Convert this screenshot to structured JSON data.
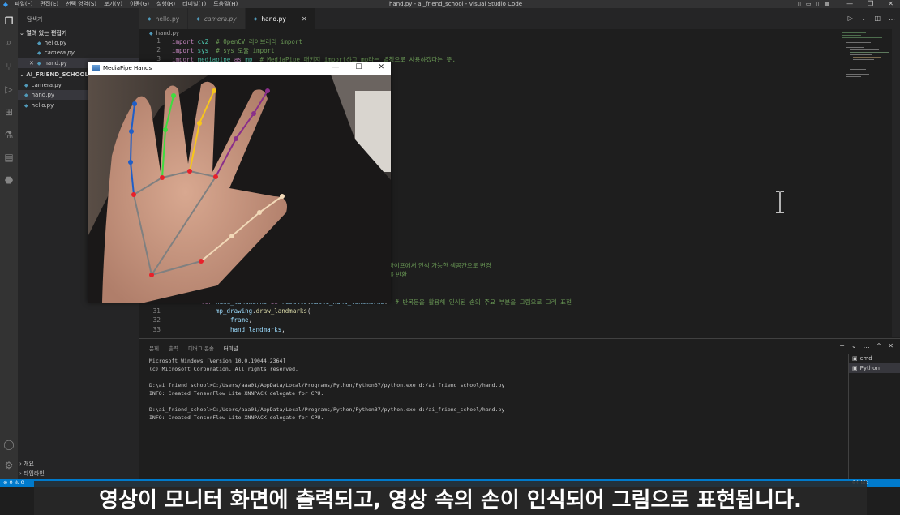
{
  "window": {
    "title": "hand.py - ai_friend_school - Visual Studio Code",
    "menu": [
      "파일(F)",
      "편집(E)",
      "선택 영역(S)",
      "보기(V)",
      "이동(G)",
      "실행(R)",
      "터미널(T)",
      "도움말(H)"
    ]
  },
  "sidebar": {
    "header": "탐색기",
    "open_editors_title": "열려 있는 편집기",
    "open_editors": [
      "hello.py",
      "camera.py",
      "hand.py"
    ],
    "folder_title": "AI_FRIEND_SCHOOL",
    "files": [
      "camera.py",
      "hand.py",
      "hello.py"
    ],
    "outline": "개요",
    "timeline": "타임라인"
  },
  "tabs": [
    {
      "label": "hello.py",
      "active": false,
      "italic": false
    },
    {
      "label": "camera.py",
      "active": false,
      "italic": true
    },
    {
      "label": "hand.py",
      "active": true,
      "italic": false
    }
  ],
  "breadcrumb": "hand.py",
  "code": {
    "lines_top": [
      {
        "n": "1",
        "parts": [
          [
            "kw",
            "import "
          ],
          [
            "mod",
            "cv2"
          ],
          [
            "txt",
            "  "
          ],
          [
            "cm",
            "# OpenCV 라이브러리 import"
          ]
        ]
      },
      {
        "n": "2",
        "parts": [
          [
            "kw",
            "import "
          ],
          [
            "mod",
            "sys"
          ],
          [
            "txt",
            "  "
          ],
          [
            "cm",
            "# sys 모듈 import"
          ]
        ]
      },
      {
        "n": "3",
        "parts": [
          [
            "kw",
            "import "
          ],
          [
            "mod",
            "mediapipe"
          ],
          [
            "kw",
            " as "
          ],
          [
            "mod",
            "mp"
          ],
          [
            "txt",
            "  "
          ],
          [
            "cm",
            "# MediaPipe 패키지 import하고 mp라는 별칭으로 사용하겠다는 뜻."
          ]
        ]
      }
    ],
    "fragment_1": "파이프에서 인식 가능한 색공간으로 변경",
    "fragment_2": "를 반환",
    "lines_bottom": [
      {
        "n": "30",
        "parts": [
          [
            "kw",
            "for "
          ],
          [
            "var",
            "hand_landmarks"
          ],
          [
            "kw",
            " in "
          ],
          [
            "var",
            "results"
          ],
          [
            "txt",
            "."
          ],
          [
            "var",
            "multi_hand_landmarks"
          ],
          [
            "txt",
            ":  "
          ],
          [
            "cm",
            "# 반복문을 활용해 인식된 손의 주요 부분을 그림으로 그려 표현"
          ]
        ]
      },
      {
        "n": "31",
        "parts": [
          [
            "var",
            "mp_drawing"
          ],
          [
            "txt",
            "."
          ],
          [
            "fn",
            "draw_landmarks"
          ],
          [
            "txt",
            "("
          ]
        ]
      },
      {
        "n": "32",
        "parts": [
          [
            "var",
            "frame"
          ],
          [
            "txt",
            ","
          ]
        ]
      },
      {
        "n": "33",
        "parts": [
          [
            "var",
            "hand_landmarks"
          ],
          [
            "txt",
            ","
          ]
        ]
      }
    ]
  },
  "panel": {
    "tabs": [
      "문제",
      "출력",
      "디버그 콘솔",
      "터미널"
    ],
    "active_tab": "터미널",
    "terminal_lines": [
      "Microsoft Windows [Version 10.0.19044.2364]",
      "(c) Microsoft Corporation. All rights reserved.",
      "",
      "D:\\ai_friend_school>C:/Users/aaa01/AppData/Local/Programs/Python/Python37/python.exe d:/ai_friend_school/hand.py",
      "INFO: Created TensorFlow Lite XNNPACK delegate for CPU.",
      "",
      "D:\\ai_friend_school>C:/Users/aaa01/AppData/Local/Programs/Python/Python37/python.exe d:/ai_friend_school/hand.py",
      "INFO: Created TensorFlow Lite XNNPACK delegate for CPU."
    ],
    "terminals": [
      "cmd",
      "Python"
    ],
    "plus": "+",
    "more": "…",
    "maximize": "^",
    "close": "✕"
  },
  "status": {
    "problems": "⊗ 0 ⚠ 0",
    "right": "64-bit"
  },
  "camera_window": {
    "title": "MediaPipe Hands",
    "minimize": "—",
    "maximize": "☐",
    "close": "✕"
  },
  "subtitle": "영상이 모니터 화면에 출력되고, 영상 속의 손이 인식되어 그림으로 표현됩니다.",
  "colors": {
    "accent": "#007acc",
    "editor_bg": "#1e1e1e",
    "sidebar_bg": "#252526",
    "activity_bg": "#333333",
    "landmark_red": "#e8202a",
    "landmark_blue": "#1e5ec8",
    "landmark_green": "#3fdc3f",
    "landmark_yellow": "#f7c61a",
    "landmark_purple": "#8a2f8a",
    "landmark_beige": "#f2d9b8",
    "connection_gray": "#808080"
  }
}
